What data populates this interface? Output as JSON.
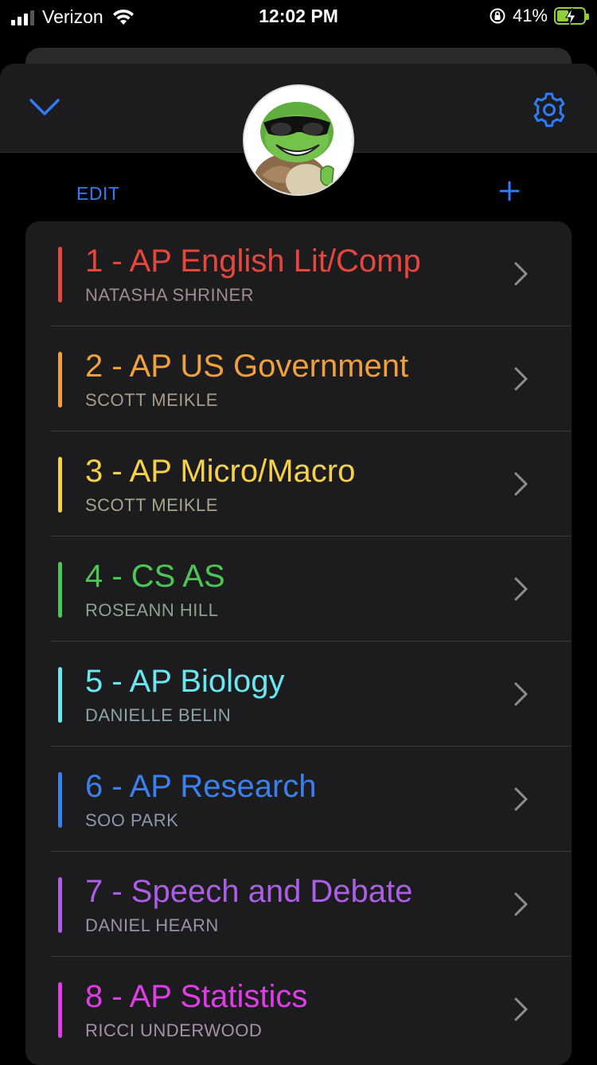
{
  "status_bar": {
    "carrier": "Verizon",
    "time": "12:02 PM",
    "battery": "41%"
  },
  "header": {
    "edit_label": "EDIT",
    "icons": {
      "collapse": "chevron-down-icon",
      "settings": "gear-icon",
      "add": "plus-icon"
    }
  },
  "accent_color": "#2f7cf6",
  "classes": [
    {
      "title": "1 - AP English Lit/Comp",
      "teacher": "NATASHA SHRINER",
      "color": "#e6463c",
      "teacher_color": "#a08c88"
    },
    {
      "title": "2 - AP US Government",
      "teacher": "SCOTT MEIKLE",
      "color": "#f0a03c",
      "teacher_color": "#a89c88"
    },
    {
      "title": "3 - AP Micro/Macro",
      "teacher": "SCOTT MEIKLE",
      "color": "#f5d048",
      "teacher_color": "#a8a48c"
    },
    {
      "title": "4 - CS AS",
      "teacher": "ROSEANN HILL",
      "color": "#4cc756",
      "teacher_color": "#8ca48c"
    },
    {
      "title": "5 - AP Biology",
      "teacher": "DANIELLE BELIN",
      "color": "#6ae6f0",
      "teacher_color": "#8ca4a8"
    },
    {
      "title": "6 - AP Research",
      "teacher": "SOO PARK",
      "color": "#3a80ee",
      "teacher_color": "#8c98ac"
    },
    {
      "title": "7 - Speech and Debate",
      "teacher": "DANIEL HEARN",
      "color": "#ad5ee6",
      "teacher_color": "#9c90a8"
    },
    {
      "title": "8 - AP Statistics",
      "teacher": "RICCI UNDERWOOD",
      "color": "#e03ce8",
      "teacher_color": "#a890a8"
    }
  ]
}
